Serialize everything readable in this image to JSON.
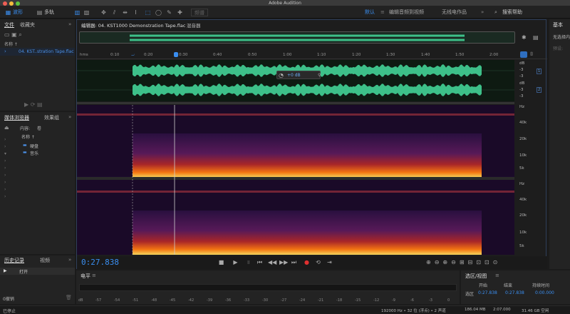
{
  "window": {
    "title": "Adobe Audition",
    "traffic": [
      "#ee5e55",
      "#f4bc3d",
      "#5cc23f"
    ]
  },
  "toolbar": {
    "waveform": "波形",
    "multitrack": "多轨",
    "spectrum_btn": "频谱"
  },
  "workspace": {
    "items": [
      "默认",
      "编辑音频到视频",
      "无线电作品"
    ],
    "search_placeholder": "搜索帮助"
  },
  "files_panel": {
    "tabs": [
      "文件",
      "收藏夹"
    ],
    "header": "名称 ↑",
    "file": "04. KST..stration Tape.flac"
  },
  "media_panel": {
    "tabs": [
      "媒体浏览器",
      "效果组"
    ],
    "subtabs": [
      "内容:",
      "卷"
    ],
    "header": "名称 ↑",
    "items": [
      "硬盘",
      "音乐"
    ]
  },
  "history_panel": {
    "tabs": [
      "历史记录",
      "视频"
    ],
    "item": "打开",
    "undo": "0撤销"
  },
  "editor": {
    "tab": "编辑器: 04. KST1000 Demonstration Tape.flac",
    "mixer_tab": "混音器",
    "timecode": "0:27.838",
    "ruler_unit": "hms",
    "ruler": [
      "0:10",
      "0:20",
      "0:30",
      "0:40",
      "0:50",
      "1:00",
      "1:10",
      "1:20",
      "1:30",
      "1:40",
      "1:50",
      "2:00"
    ],
    "gain_value": "+0 dB",
    "db_labels": [
      "dB",
      "-3",
      "-3",
      "dB",
      "-3",
      "-3"
    ],
    "channels": [
      "1",
      "2"
    ],
    "hz_labels": [
      "Hz",
      "40k",
      "20k",
      "10k",
      "5k",
      "Hz",
      "40k",
      "20k",
      "10k",
      "5k"
    ]
  },
  "levels": {
    "title": "电平",
    "ticks": [
      "dB",
      "-57",
      "-54",
      "-51",
      "-48",
      "-45",
      "-42",
      "-39",
      "-36",
      "-33",
      "-30",
      "-27",
      "-24",
      "-21",
      "-18",
      "-15",
      "-12",
      "-9",
      "-6",
      "-3",
      "0"
    ]
  },
  "selection": {
    "title": "选区/视图",
    "headers": [
      "开始",
      "结束",
      "持续时间"
    ],
    "row_label": "选区",
    "start": "0:27.838",
    "end": "0:27.838",
    "duration": "0:00.000"
  },
  "status": {
    "left": "已停止",
    "sample": "192000 Hz • 32 位 (浮点) • 2 声道",
    "size": "186.04 MB",
    "duration": "2:07.000",
    "space": "31.46 GB 空闲"
  },
  "right_panel": {
    "title": "基本",
    "line1": "无选择内容",
    "line2": "预设:"
  },
  "icons": [
    "waveform-icon",
    "multitrack-icon",
    "move-tool-icon",
    "razor-icon",
    "marquee-icon",
    "lasso-icon",
    "brush-icon",
    "spot-heal-icon"
  ]
}
